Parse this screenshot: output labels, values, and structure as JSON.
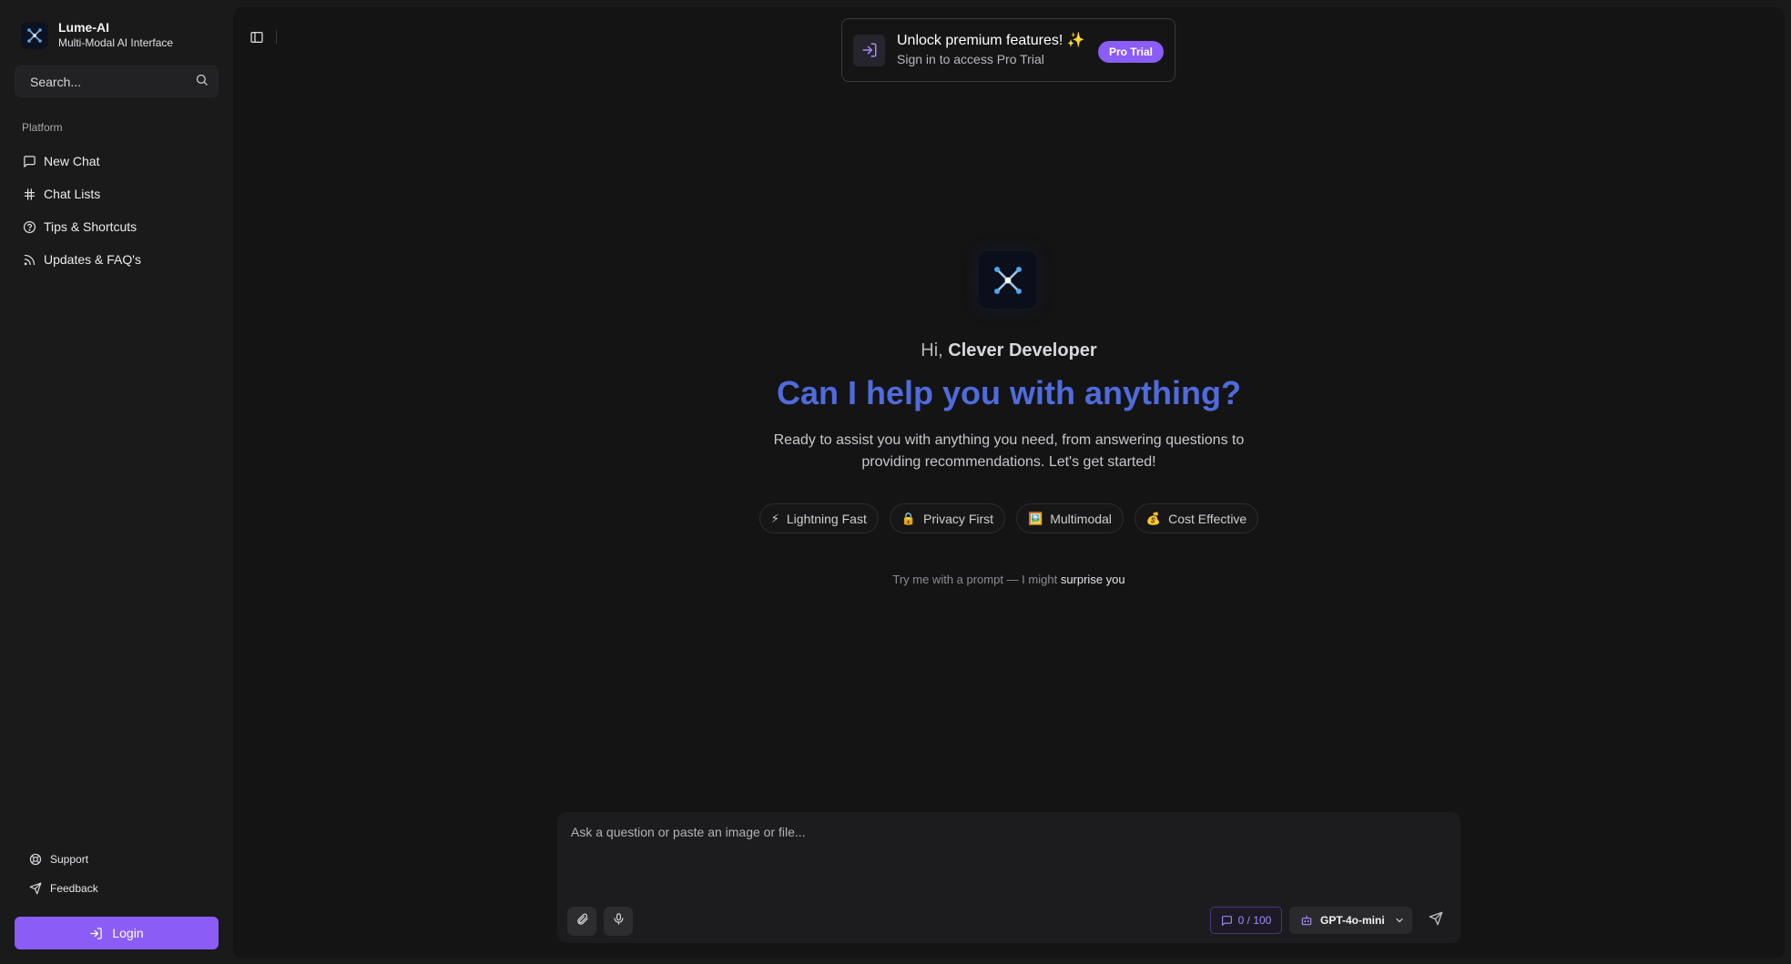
{
  "brand": {
    "name": "Lume-AI",
    "subtitle": "Multi-Modal AI Interface"
  },
  "search": {
    "placeholder": "Search..."
  },
  "sidebar": {
    "section_label": "Platform",
    "items": [
      {
        "label": "New Chat",
        "icon": "message-square-icon"
      },
      {
        "label": "Chat Lists",
        "icon": "hash-icon"
      },
      {
        "label": "Tips & Shortcuts",
        "icon": "help-circle-icon"
      },
      {
        "label": "Updates & FAQ's",
        "icon": "rss-icon"
      }
    ],
    "footer": [
      {
        "label": "Support",
        "icon": "life-buoy-icon"
      },
      {
        "label": "Feedback",
        "icon": "send-icon"
      }
    ],
    "login_label": "Login"
  },
  "promo": {
    "title": "Unlock premium features! ✨",
    "subtitle": "Sign in to access Pro Trial",
    "badge": "Pro Trial"
  },
  "hero": {
    "greeting_prefix": "Hi, ",
    "user_name": "Clever Developer",
    "headline": "Can I help you with anything?",
    "description": "Ready to assist you with anything you need, from answering questions to providing recommendations. Let's get started!",
    "features": [
      {
        "emoji": "⚡",
        "label": "Lightning Fast"
      },
      {
        "emoji": "🔒",
        "label": "Privacy First"
      },
      {
        "emoji": "🖼️",
        "label": "Multimodal"
      },
      {
        "emoji": "💰",
        "label": "Cost Effective"
      }
    ],
    "tryme_prefix": "Try me with a prompt — I might ",
    "tryme_highlight": "surprise you"
  },
  "composer": {
    "placeholder": "Ask a question or paste an image or file...",
    "counter": "0 / 100",
    "model": "GPT-4o-mini"
  },
  "colors": {
    "accent": "#8b5cf6",
    "headline": "#4f6bdc",
    "background": "#141415",
    "sidebar": "#1a1a1b"
  }
}
